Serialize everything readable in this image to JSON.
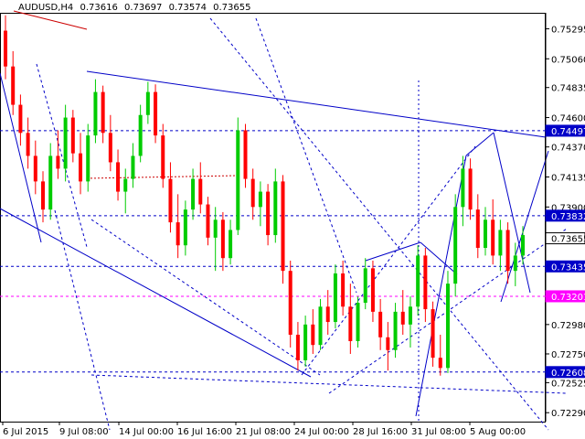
{
  "header": {
    "symbol": "AUDUSD,H4",
    "open": "0.73616",
    "high": "0.73697",
    "low": "0.73574",
    "close": "0.73655"
  },
  "chart_data": {
    "type": "candlestick",
    "symbol": "AUDUSD",
    "timeframe": "H4",
    "ylim": [
      0.7222,
      0.7542
    ],
    "y_ticks": [
      "0.75295",
      "0.75060",
      "0.74835",
      "0.74600",
      "0.74370",
      "0.74135",
      "0.73900",
      "0.73665",
      "0.73435",
      "0.73200",
      "0.72980",
      "0.72750",
      "0.72525",
      "0.72290"
    ],
    "x_ticks": [
      "6 Jul 2015",
      "9 Jul 08:00",
      "14 Jul 00:00",
      "16 Jul 16:00",
      "21 Jul 08:00",
      "24 Jul 00:00",
      "28 Jul 16:00",
      "31 Jul 08:00",
      "5 Aug 00:00"
    ],
    "price_levels": [
      {
        "label": "0.74497",
        "value": 0.74497,
        "color": "#0000c8",
        "style": "dashed"
      },
      {
        "label": "0.73832",
        "value": 0.73832,
        "color": "#0000c8",
        "style": "dashed"
      },
      {
        "label": "0.73655",
        "value": 0.73655,
        "color": "#ffffff",
        "text_color": "#000000",
        "style": "current"
      },
      {
        "label": "0.73435",
        "value": 0.73435,
        "color": "#0000c8",
        "style": "dashed"
      },
      {
        "label": "0.73201",
        "value": 0.73201,
        "color": "#ff00ff",
        "style": "dashed"
      },
      {
        "label": "0.72608",
        "value": 0.72608,
        "color": "#0000c8",
        "style": "dashed"
      }
    ],
    "up_color": "#00cc00",
    "down_color": "#ff0000",
    "line_color": "#0000c8",
    "grid": false,
    "candles": [
      [
        0.7528,
        0.754,
        0.749,
        0.75
      ],
      [
        0.75,
        0.7512,
        0.7462,
        0.747
      ],
      [
        0.747,
        0.7478,
        0.7438,
        0.7448
      ],
      [
        0.7448,
        0.746,
        0.742,
        0.743
      ],
      [
        0.743,
        0.7442,
        0.74,
        0.741
      ],
      [
        0.741,
        0.7418,
        0.7378,
        0.7388
      ],
      [
        0.7388,
        0.744,
        0.738,
        0.743
      ],
      [
        0.743,
        0.745,
        0.7412,
        0.742
      ],
      [
        0.742,
        0.747,
        0.741,
        0.746
      ],
      [
        0.746,
        0.7466,
        0.7425,
        0.7432
      ],
      [
        0.7432,
        0.7448,
        0.74,
        0.741
      ],
      [
        0.741,
        0.7455,
        0.7402,
        0.7446
      ],
      [
        0.7446,
        0.749,
        0.744,
        0.748
      ],
      [
        0.748,
        0.7485,
        0.744,
        0.7448
      ],
      [
        0.7448,
        0.7462,
        0.7418,
        0.7425
      ],
      [
        0.7425,
        0.7435,
        0.7395,
        0.7402
      ],
      [
        0.7402,
        0.742,
        0.7385,
        0.7412
      ],
      [
        0.7412,
        0.744,
        0.7405,
        0.743
      ],
      [
        0.743,
        0.747,
        0.7425,
        0.7462
      ],
      [
        0.7462,
        0.7488,
        0.7455,
        0.748
      ],
      [
        0.748,
        0.7486,
        0.744,
        0.7446
      ],
      [
        0.7446,
        0.7455,
        0.7405,
        0.7412
      ],
      [
        0.7412,
        0.7425,
        0.737,
        0.7378
      ],
      [
        0.7378,
        0.74,
        0.735,
        0.736
      ],
      [
        0.736,
        0.7395,
        0.7352,
        0.7388
      ],
      [
        0.7388,
        0.742,
        0.738,
        0.7412
      ],
      [
        0.7412,
        0.7425,
        0.7385,
        0.7392
      ],
      [
        0.7392,
        0.7398,
        0.736,
        0.7366
      ],
      [
        0.7366,
        0.739,
        0.734,
        0.738
      ],
      [
        0.738,
        0.7386,
        0.734,
        0.735
      ],
      [
        0.735,
        0.738,
        0.7345,
        0.7372
      ],
      [
        0.7372,
        0.746,
        0.7368,
        0.745
      ],
      [
        0.745,
        0.7455,
        0.7405,
        0.7412
      ],
      [
        0.7412,
        0.742,
        0.738,
        0.739
      ],
      [
        0.739,
        0.741,
        0.7375,
        0.7402
      ],
      [
        0.7402,
        0.7408,
        0.736,
        0.7368
      ],
      [
        0.7368,
        0.742,
        0.7362,
        0.741
      ],
      [
        0.741,
        0.7415,
        0.733,
        0.734
      ],
      [
        0.734,
        0.7348,
        0.728,
        0.729
      ],
      [
        0.729,
        0.73,
        0.7262,
        0.727
      ],
      [
        0.727,
        0.7305,
        0.7265,
        0.7298
      ],
      [
        0.7298,
        0.731,
        0.7275,
        0.7282
      ],
      [
        0.7282,
        0.7318,
        0.7278,
        0.7312
      ],
      [
        0.7312,
        0.7325,
        0.729,
        0.73
      ],
      [
        0.73,
        0.7345,
        0.7295,
        0.7338
      ],
      [
        0.7338,
        0.7348,
        0.7305,
        0.7312
      ],
      [
        0.7312,
        0.733,
        0.7275,
        0.7285
      ],
      [
        0.7285,
        0.732,
        0.728,
        0.7315
      ],
      [
        0.7315,
        0.735,
        0.731,
        0.7342
      ],
      [
        0.7342,
        0.7348,
        0.73,
        0.7308
      ],
      [
        0.7308,
        0.7318,
        0.7278,
        0.7288
      ],
      [
        0.7288,
        0.73,
        0.7262,
        0.7278
      ],
      [
        0.7278,
        0.7315,
        0.7272,
        0.7308
      ],
      [
        0.7308,
        0.7325,
        0.729,
        0.7298
      ],
      [
        0.7298,
        0.732,
        0.728,
        0.7312
      ],
      [
        0.7312,
        0.736,
        0.7305,
        0.7352
      ],
      [
        0.7352,
        0.7358,
        0.73,
        0.731
      ],
      [
        0.731,
        0.7316,
        0.7265,
        0.7272
      ],
      [
        0.7272,
        0.729,
        0.7258,
        0.7264
      ],
      [
        0.7264,
        0.734,
        0.726,
        0.733
      ],
      [
        0.733,
        0.74,
        0.732,
        0.739
      ],
      [
        0.739,
        0.743,
        0.7375,
        0.742
      ],
      [
        0.742,
        0.7428,
        0.738,
        0.7388
      ],
      [
        0.7388,
        0.74,
        0.735,
        0.7358
      ],
      [
        0.7358,
        0.739,
        0.7352,
        0.738
      ],
      [
        0.738,
        0.7396,
        0.7345,
        0.7352
      ],
      [
        0.7352,
        0.738,
        0.734,
        0.7372
      ],
      [
        0.7372,
        0.7378,
        0.733,
        0.734
      ],
      [
        0.734,
        0.7362,
        0.7328,
        0.7352
      ],
      [
        0.7352,
        0.7375,
        0.7345,
        0.7368
      ]
    ]
  }
}
